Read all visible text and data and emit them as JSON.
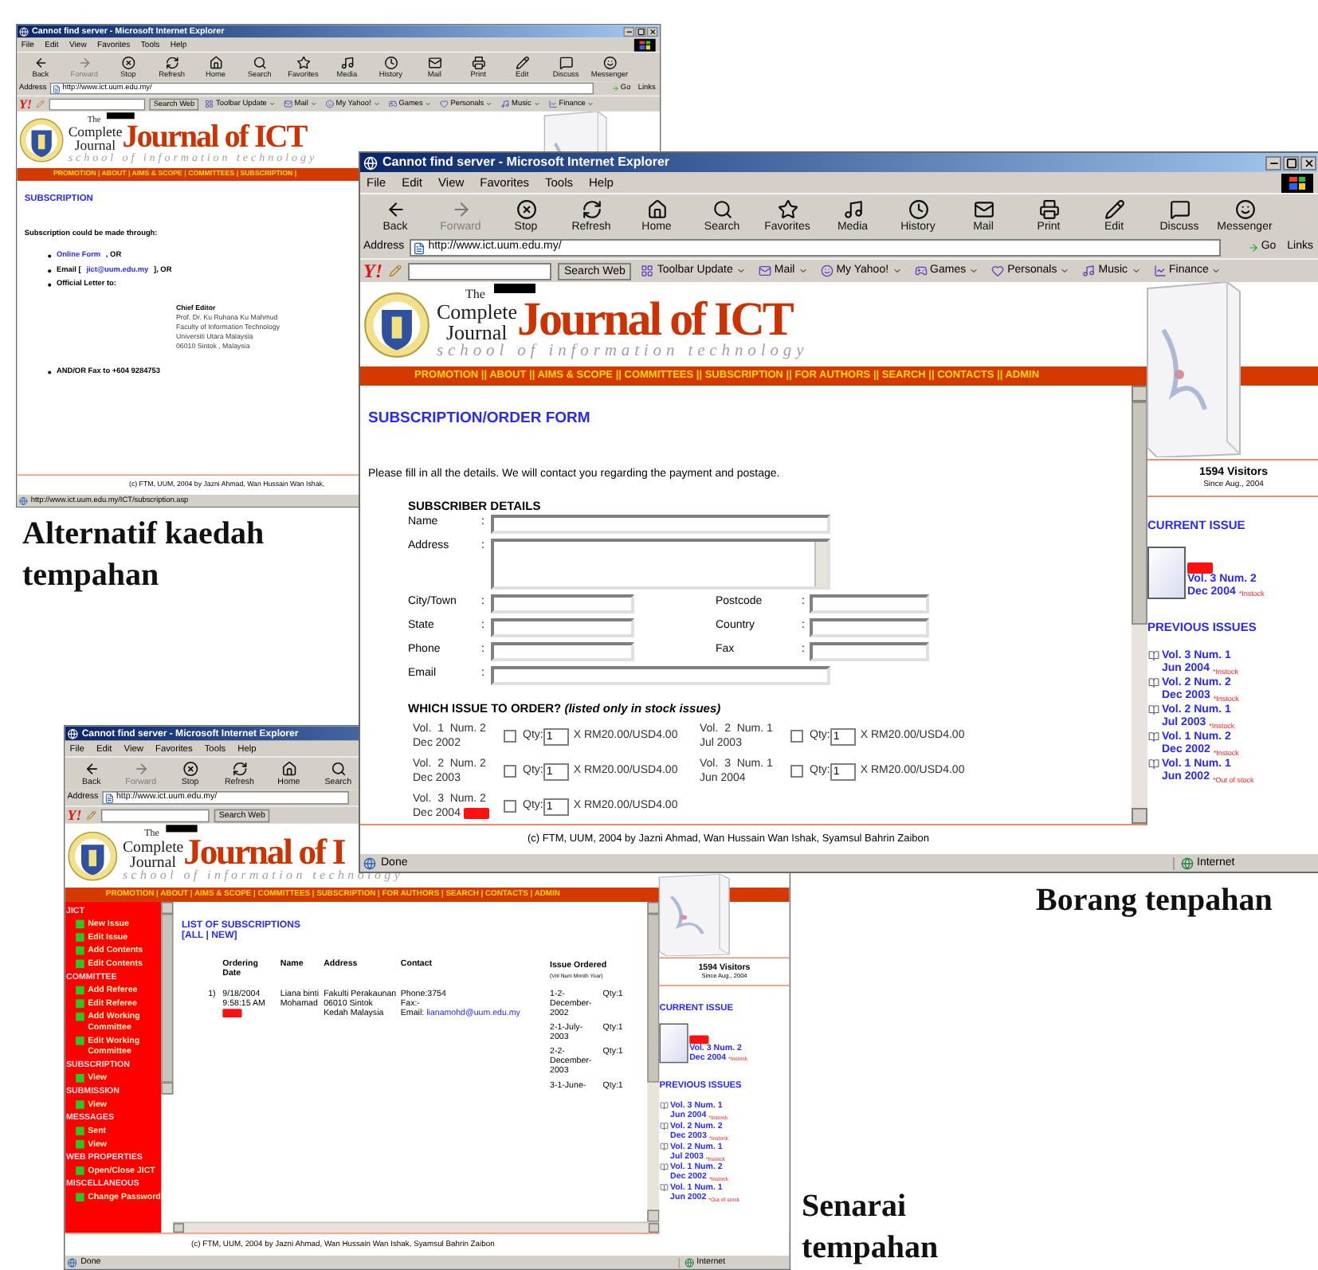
{
  "windows": [
    {
      "kind": "info",
      "title": "Cannot find server - Microsoft Internet Explorer",
      "menu": [
        "File",
        "Edit",
        "View",
        "Favorites",
        "Tools",
        "Help"
      ],
      "toolbar": [
        {
          "label": "Back",
          "disabled": false
        },
        {
          "label": "Forward",
          "disabled": true
        },
        {
          "label": "Stop",
          "disabled": false
        },
        {
          "label": "Refresh",
          "disabled": false
        },
        {
          "label": "Home",
          "disabled": false
        },
        {
          "label": "Search",
          "disabled": false
        },
        {
          "label": "Favorites",
          "disabled": false
        },
        {
          "label": "Media",
          "disabled": false
        },
        {
          "label": "History",
          "disabled": false
        },
        {
          "label": "Mail",
          "disabled": false
        },
        {
          "label": "Print",
          "disabled": false
        },
        {
          "label": "Edit",
          "disabled": false
        },
        {
          "label": "Discuss",
          "disabled": false
        },
        {
          "label": "Messenger",
          "disabled": false
        }
      ],
      "address": {
        "label": "Address",
        "url": "http://www.ict.uum.edu.my/",
        "go": "Go",
        "links": "Links"
      },
      "yahoo": {
        "logo": "Y!",
        "button": "Search Web",
        "items": [
          "Toolbar Update",
          "Mail",
          "My Yahoo!",
          "Games",
          "Personals",
          "Music",
          "Finance"
        ]
      },
      "logo": {
        "small": "The",
        "line1": "Complete",
        "line2": "Journal",
        "name": "Journal of ICT",
        "tagline": "school of information technology"
      },
      "nav": "PROMOTION | ABOUT | AIMS & SCOPE | COMMITTEES | SUBSCRIPTION |",
      "body": {
        "heading": "SUBSCRIPTION",
        "intro": "Subscription could be made through:",
        "bullets": [
          {
            "link": "Online Form",
            "text": ", OR"
          },
          {
            "pre": "Email [",
            "link": "jict@uum.edu.my",
            "text": "], OR"
          },
          {
            "text": "Official Letter to:"
          }
        ],
        "address_title": "Chief Editor",
        "address_lines": [
          "Prof. Dr. Ku Ruhana Ku Mahmud",
          "Faculty of Information Technology",
          "Universiti Utara Malaysia",
          "06010 Sintok , Malaysia"
        ],
        "fax": "AND/OR Fax to +604 9284753"
      },
      "footer": "(c) FTM, UUM, 2004 by Jazni Ahmad, Wan Hussain Wan Ishak,",
      "status": {
        "text": "http://www.ict.uum.edu.my/ICT/subscription.asp"
      }
    },
    {
      "kind": "form",
      "title": "Cannot find server - Microsoft Internet Explorer",
      "menu": [
        "File",
        "Edit",
        "View",
        "Favorites",
        "Tools",
        "Help"
      ],
      "toolbar": [
        {
          "label": "Back",
          "disabled": false
        },
        {
          "label": "Forward",
          "disabled": true
        },
        {
          "label": "Stop",
          "disabled": false
        },
        {
          "label": "Refresh",
          "disabled": false
        },
        {
          "label": "Home",
          "disabled": false
        },
        {
          "label": "Search",
          "disabled": false
        },
        {
          "label": "Favorites",
          "disabled": false
        },
        {
          "label": "Media",
          "disabled": false
        },
        {
          "label": "History",
          "disabled": false
        },
        {
          "label": "Mail",
          "disabled": false
        },
        {
          "label": "Print",
          "disabled": false
        },
        {
          "label": "Edit",
          "disabled": false
        },
        {
          "label": "Discuss",
          "disabled": false
        },
        {
          "label": "Messenger",
          "disabled": false
        }
      ],
      "address": {
        "label": "Address",
        "url": "http://www.ict.uum.edu.my/",
        "go": "Go",
        "links": "Links"
      },
      "yahoo": {
        "logo": "Y!",
        "button": "Search Web",
        "items": [
          "Toolbar Update",
          "Mail",
          "My Yahoo!",
          "Games",
          "Personals",
          "Music",
          "Finance"
        ]
      },
      "logo": {
        "small": "The",
        "line1": "Complete",
        "line2": "Journal",
        "name": "Journal of ICT",
        "tagline": "school of information technology"
      },
      "nav": "PROMOTION || ABOUT || AIMS & SCOPE || COMMITTEES || SUBSCRIPTION || FOR AUTHORS || SEARCH || CONTACTS || ADMIN",
      "body": {
        "heading": "SUBSCRIPTION/ORDER FORM",
        "intro": "Please fill in all the details.  We will contact you regarding the payment and postage.",
        "section": "SUBSCRIBER DETAILS",
        "fields": [
          {
            "label": "Name",
            "colon": ":",
            "kind": "long"
          },
          {
            "label": "Address",
            "colon": ":",
            "kind": "area"
          },
          {
            "label": "City/Town",
            "colon": ":",
            "kind": "short"
          },
          {
            "label": "Postcode",
            "colon": ":",
            "kind": "short"
          },
          {
            "label": "State",
            "colon": ":",
            "kind": "short"
          },
          {
            "label": "Country",
            "colon": ":",
            "kind": "short"
          },
          {
            "label": "Phone",
            "colon": ":",
            "kind": "short"
          },
          {
            "label": "Fax",
            "colon": ":",
            "kind": "short"
          },
          {
            "label": "Email",
            "colon": ":",
            "kind": "long"
          }
        ],
        "issues_heading": "WHICH ISSUE TO ORDER? *(listed only in stock issues)*",
        "issues": [
          {
            "vol": "Vol.  1  Num. 2",
            "date": "Dec 2002",
            "new": false,
            "checked": false,
            "qty_label": "Qty:",
            "qty": "1",
            "price": "X RM20.00/USD4.00"
          },
          {
            "vol": "Vol.  2  Num. 1",
            "date": "Jul 2003",
            "new": false,
            "checked": false,
            "qty_label": "Qty:",
            "qty": "1",
            "price": "X RM20.00/USD4.00"
          },
          {
            "vol": "Vol.  2  Num. 2",
            "date": "Dec 2003",
            "new": false,
            "checked": false,
            "qty_label": "Qty:",
            "qty": "1",
            "price": "X RM20.00/USD4.00"
          },
          {
            "vol": "Vol.  3  Num. 1",
            "date": "Jun 2004",
            "new": false,
            "checked": false,
            "qty_label": "Qty:",
            "qty": "1",
            "price": "X RM20.00/USD4.00"
          },
          {
            "vol": "Vol.  3  Num. 2",
            "date": "Dec 2004",
            "new": true,
            "checked": false,
            "qty_label": "Qty:",
            "qty": "1",
            "price": "X RM20.00/USD4.00"
          }
        ]
      },
      "sidebar": {
        "visitors": "1594 Visitors",
        "since": "Since Aug., 2004",
        "current_heading": "CURRENT ISSUE",
        "current": {
          "new": true,
          "title": "Vol. 3 Num. 2",
          "date": "Dec 2004",
          "status": "*Instock"
        },
        "previous_heading": "PREVIOUS ISSUES",
        "previous": [
          {
            "title": "Vol. 3 Num. 1",
            "date": "Jun 2004",
            "status": "*Instock"
          },
          {
            "title": "Vol. 2 Num. 2",
            "date": "Dec 2003",
            "status": "*Instock"
          },
          {
            "title": "Vol. 2 Num. 1",
            "date": "Jul 2003",
            "status": "*Instock"
          },
          {
            "title": "Vol. 1 Num. 2",
            "date": "Dec 2002",
            "status": "*Instock"
          },
          {
            "title": "Vol. 1 Num. 1",
            "date": "Jun 2002",
            "status": "*Out of stock"
          }
        ]
      },
      "footer": "(c) FTM, UUM, 2004 by Jazni Ahmad, Wan Hussain Wan Ishak, Syamsul Bahrin Zaibon",
      "status": {
        "text": "Done",
        "zone": "Internet"
      }
    },
    {
      "kind": "list",
      "title": "Cannot find server - Microsoft Internet Explorer",
      "menu": [
        "File",
        "Edit",
        "View",
        "Favorites",
        "Tools",
        "Help"
      ],
      "toolbar": [
        {
          "label": "Back",
          "disabled": false
        },
        {
          "label": "Forward",
          "disabled": true
        },
        {
          "label": "Stop",
          "disabled": false
        },
        {
          "label": "Refresh",
          "disabled": false
        },
        {
          "label": "Home",
          "disabled": false
        },
        {
          "label": "Search",
          "disabled": false
        }
      ],
      "address": {
        "label": "Address",
        "url": "http://www.ict.uum.edu.my/"
      },
      "yahoo": {
        "logo": "Y!",
        "button": "Search Web"
      },
      "logo": {
        "small": "The",
        "line1": "Complete",
        "line2": "Journal",
        "name": "Journal of I",
        "tagline": "school of information technology"
      },
      "nav": "PROMOTION | ABOUT | AIMS & SCOPE | COMMITTEES | SUBSCRIPTION | FOR AUTHORS | SEARCH | CONTACTS | ADMIN",
      "admin": [
        {
          "heading": "JICT",
          "items": [
            "New Issue",
            "Edit Issue",
            "Add Contents",
            "Edit Contents"
          ]
        },
        {
          "heading": "COMMITTEE",
          "items": [
            "Add Referee",
            "Edit Referee",
            "Add Working Committee",
            "Edit Working Committee"
          ]
        },
        {
          "heading": "SUBSCRIPTION",
          "items": [
            "View"
          ]
        },
        {
          "heading": "SUBMISSION",
          "items": [
            "View"
          ]
        },
        {
          "heading": "MESSAGES",
          "items": [
            "Sent",
            "View"
          ]
        },
        {
          "heading": "WEB PROPERTIES",
          "items": [
            "Open/Close JICT"
          ]
        },
        {
          "heading": "MISCELLANEOUS",
          "items": [
            "Change Password"
          ]
        }
      ],
      "body": {
        "heading": "LIST OF SUBSCRIPTIONS",
        "filter": "[ALL | NEW]",
        "columns": [
          "Ordering Date",
          "Name",
          "Address",
          "Contact",
          "Issue Ordered"
        ],
        "issue_note": "(Vol Num Month Year)",
        "rows": [
          {
            "number": "1)",
            "date": "9/18/2004 9:58:15 AM",
            "new": true,
            "name": "Liana binti Mohamad",
            "address": "Fakulti Perakaunan 06010 Sintok Kedah Malaysia",
            "contact": [
              {
                "text": "Phone:3754"
              },
              {
                "text": "Fax:-"
              },
              {
                "text": "Email:",
                "link": "lianamohd@uum.edu.my"
              }
            ],
            "issues": [
              {
                "issue": "1-2-December-2002",
                "qty": "Qty:1"
              },
              {
                "issue": "2-1-July-2003",
                "qty": "Qty:1"
              },
              {
                "issue": "2-2-December-2003",
                "qty": "Qty:1"
              },
              {
                "issue": "3-1-June-",
                "qty": "Qty:1"
              }
            ]
          }
        ]
      },
      "sidebar": {
        "visitors": "1594 Visitors",
        "since": "Since Aug., 2004",
        "current_heading": "CURRENT ISSUE",
        "current": {
          "new": true,
          "title": "Vol. 3 Num. 2",
          "date": "Dec 2004",
          "status": "*Instock"
        },
        "previous_heading": "PREVIOUS ISSUES",
        "previous": [
          {
            "title": "Vol. 3 Num. 1",
            "date": "Jun 2004",
            "status": "*Instock"
          },
          {
            "title": "Vol. 2 Num. 2",
            "date": "Dec 2003",
            "status": "*Instock"
          },
          {
            "title": "Vol. 2 Num. 1",
            "date": "Jul 2003",
            "status": "*Instock"
          },
          {
            "title": "Vol. 1 Num. 2",
            "date": "Dec 2002",
            "status": "*Instock"
          },
          {
            "title": "Vol. 1 Num. 1",
            "date": "Jun 2002",
            "status": "*Out of stock"
          }
        ]
      },
      "footer": "(c) FTM, UUM, 2004 by Jazni Ahmad, Wan Hussain Wan Ishak, Syamsul Bahrin Zaibon",
      "status": {
        "text": "Done",
        "zone": "Internet"
      }
    }
  ],
  "captions": [
    {
      "text": "Alternatif kaedah tempahan"
    },
    {
      "text": "Borang tenpahan"
    },
    {
      "text": "Senarai tempahan"
    }
  ]
}
